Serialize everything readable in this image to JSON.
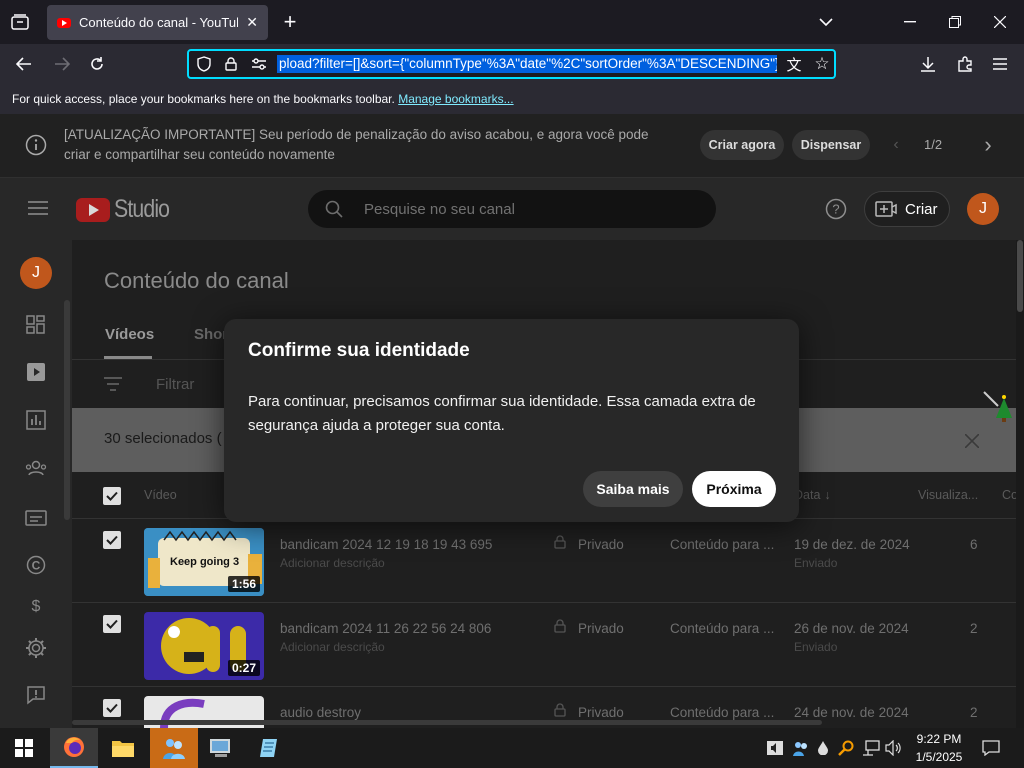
{
  "browser": {
    "tab_title": "Conteúdo do canal - YouTube S",
    "url": "pload?filter=[]&sort={\"columnType\"%3A\"date\"%2C\"sortOrder\"%3A\"DESCENDING\"}",
    "bookmarks_hint": "For quick access, place your bookmarks here on the bookmarks toolbar.",
    "bookmarks_link": "Manage bookmarks..."
  },
  "banner": {
    "text": "[ATUALIZAÇÃO IMPORTANTE] Seu período de penalização do aviso acabou, e agora você pode criar e compartilhar seu conteúdo novamente",
    "create_now": "Criar agora",
    "dismiss": "Dispensar",
    "pager": "1/2"
  },
  "studio": {
    "logo": "Studio",
    "search_placeholder": "Pesquise no seu canal",
    "create_label": "Criar",
    "avatar_letter": "J"
  },
  "page": {
    "title": "Conteúdo do canal",
    "tabs": [
      "Vídeos",
      "Shorts"
    ],
    "filter_label": "Filtrar",
    "selected_text": "30 selecionados (",
    "columns": {
      "video": "Vídeo",
      "date": "Data",
      "views": "Visualiza...",
      "comments": "Co"
    }
  },
  "rows": [
    {
      "title": "bandicam 2024 12 19 18 19 43 695",
      "desc": "Adicionar descrição",
      "duration": "1:56",
      "visibility": "Privado",
      "restrictions": "Conteúdo para ...",
      "date": "19 de dez. de 2024",
      "status": "Enviado",
      "views": "6",
      "thumb_text": "Keep going 3"
    },
    {
      "title": "bandicam 2024 11 26 22 56 24 806",
      "desc": "Adicionar descrição",
      "duration": "0:27",
      "visibility": "Privado",
      "restrictions": "Conteúdo para ...",
      "date": "26 de nov. de 2024",
      "status": "Enviado",
      "views": "2"
    },
    {
      "title": "audio destroy",
      "visibility": "Privado",
      "restrictions": "Conteúdo para ...",
      "date": "24 de nov. de 2024",
      "views": "2"
    }
  ],
  "modal": {
    "title": "Confirme sua identidade",
    "body": "Para continuar, precisamos confirmar sua identidade. Essa camada extra de segurança ajuda a proteger sua conta.",
    "learn_more": "Saiba mais",
    "next": "Próxima"
  },
  "taskbar": {
    "time": "9:22 PM",
    "date": "1/5/2025"
  },
  "colors": {
    "accent_url": "#00ddff",
    "youtube_red": "#ff0000",
    "avatar": "#c0571c"
  }
}
